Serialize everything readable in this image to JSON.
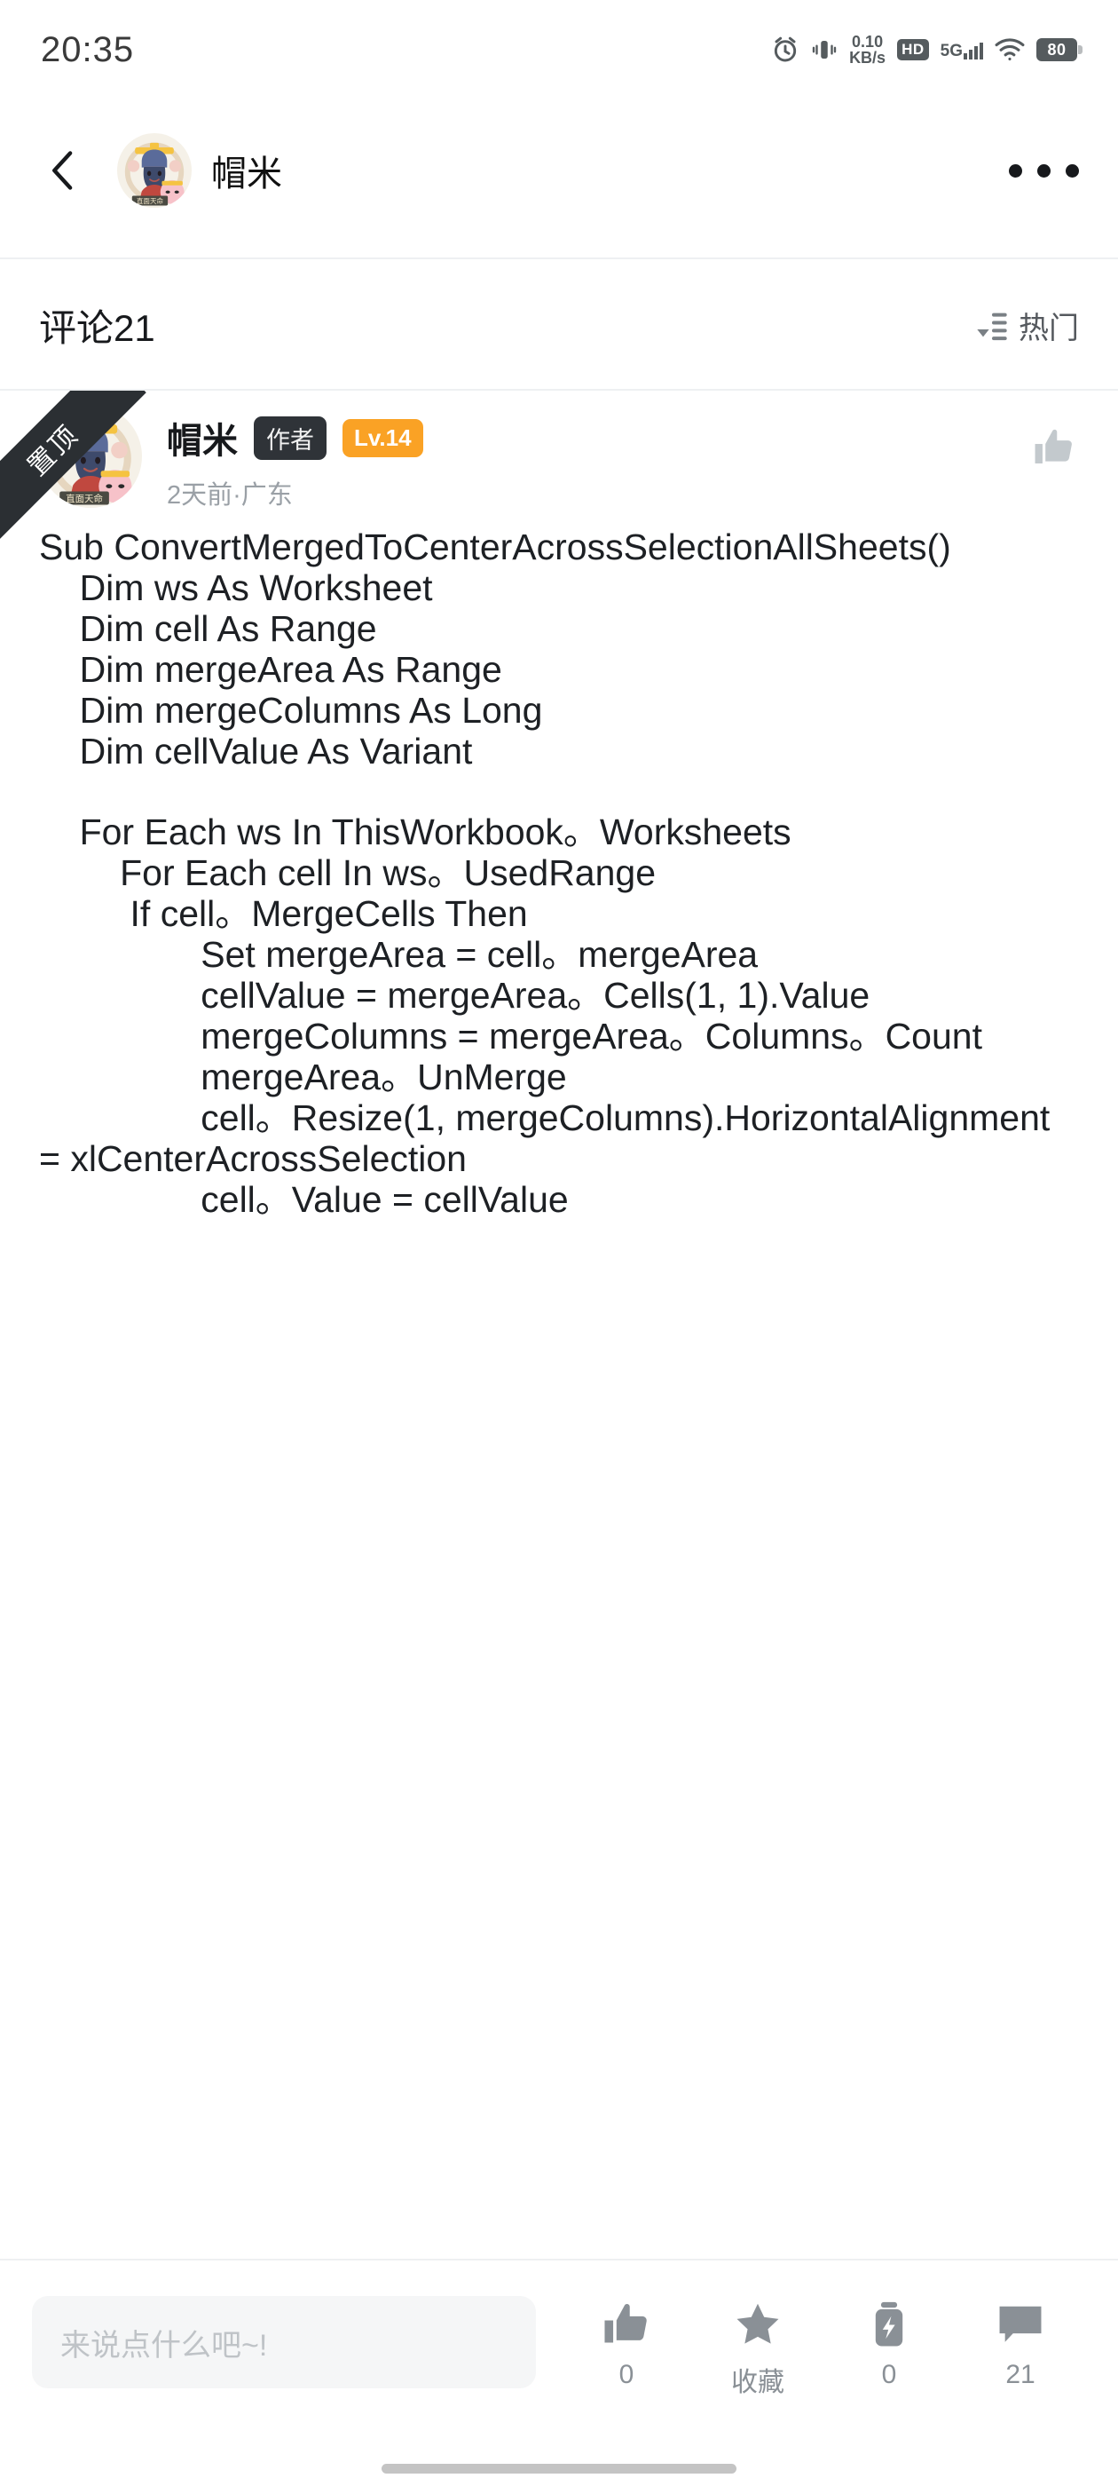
{
  "statusbar": {
    "time": "20:35",
    "netspeed_value": "0.10",
    "netspeed_unit": "KB/s",
    "hd_label": "HD",
    "network_label": "5G",
    "battery_level": "80",
    "icons": [
      "alarm-icon",
      "vibrate-icon",
      "hd-icon",
      "signal-icon",
      "wifi-icon",
      "battery-icon"
    ]
  },
  "header": {
    "back_icon": "chevron-left-icon",
    "avatar_name": "直面天命",
    "username": "帽米",
    "more_icon": "more-horizontal-icon"
  },
  "comments_bar": {
    "title": "评论21",
    "sort_label": "热门",
    "sort_icon": "sort-icon"
  },
  "comment": {
    "pinned_label": "置顶",
    "avatar_banner_text": "直面天命",
    "username": "帽米",
    "author_badge": "作者",
    "level_badge": "Lv.14",
    "time_location": "2天前·广东",
    "like_icon": "thumbs-up-icon",
    "body": "Sub ConvertMergedToCenterAcrossSelectionAllSheets()\n    Dim ws As Worksheet\n    Dim cell As Range\n    Dim mergeArea As Range\n    Dim mergeColumns As Long\n    Dim cellValue As Variant\n\n    For Each ws In ThisWorkbook。Worksheets\n        For Each cell In ws。UsedRange\n         If cell。MergeCells Then\n                Set mergeArea = cell。mergeArea\n                cellValue = mergeArea。Cells(1, 1).Value\n                mergeColumns = mergeArea。Columns。Count\n                mergeArea。UnMerge\n                cell。Resize(1, mergeColumns).HorizontalAlignment = xlCenterAcrossSelection\n                cell。Value = cellValue"
  },
  "bottombar": {
    "input_placeholder": "来说点什么吧~!",
    "actions": [
      {
        "icon": "thumbs-up-icon",
        "label": "0",
        "name": "like"
      },
      {
        "icon": "star-icon",
        "label": "收藏",
        "name": "favorite"
      },
      {
        "icon": "boost-icon",
        "label": "0",
        "name": "boost"
      },
      {
        "icon": "comment-bubble-icon",
        "label": "21",
        "name": "comment"
      }
    ]
  },
  "colors": {
    "accent_orange": "#faa225",
    "badge_dark": "#2f3338",
    "icon_gray": "#8a9096",
    "text_primary": "#17191c",
    "text_secondary": "#9aa0a6"
  }
}
